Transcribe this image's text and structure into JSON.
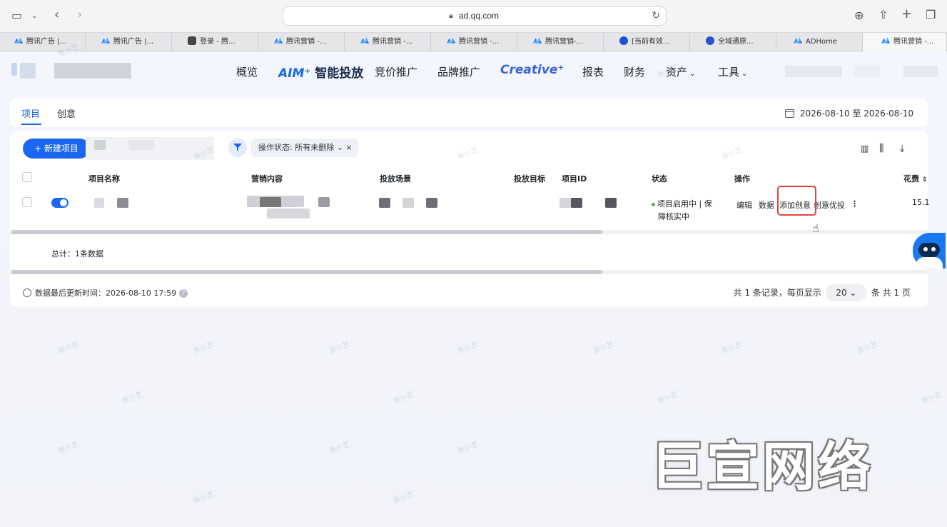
{
  "browser": {
    "url": "ad.qq.com",
    "tabs": [
      {
        "label": "腾讯广告 |...",
        "fav": "tencent-ads-icon"
      },
      {
        "label": "腾讯广告 |...",
        "fav": "tencent-ads-icon"
      },
      {
        "label": "登录 - 腾...",
        "fav": "q-icon"
      },
      {
        "label": "腾讯营销 -...",
        "fav": "tencent-ads-icon"
      },
      {
        "label": "腾讯营销 -...",
        "fav": "tencent-ads-icon"
      },
      {
        "label": "腾讯营销 -...",
        "fav": "tencent-ads-icon"
      },
      {
        "label": "腾讯营销-...",
        "fav": "tencent-ads-icon"
      },
      {
        "label": "[当前有效...",
        "fav": "it-icon"
      },
      {
        "label": "全域通原...",
        "fav": "oe-icon"
      },
      {
        "label": "ADHome",
        "fav": "tencent-ads-icon"
      },
      {
        "label": "腾讯营销 -...",
        "fav": "tencent-ads-icon"
      }
    ]
  },
  "nav": {
    "items": [
      "概览",
      "竞价推广",
      "品牌推广",
      "报表",
      "财务"
    ],
    "aim_prefix": "AIM⁺",
    "aim_label": "智能投放",
    "creative": "Creative⁺",
    "assets": "资产",
    "tools": "工具"
  },
  "subtabs": {
    "project": "项目",
    "creative": "创意",
    "date_range": "2026-08-10 至 2026-08-10"
  },
  "toolbar": {
    "new_button": "+ 新建项目",
    "filter_label": "操作状态: 所有未删除"
  },
  "table": {
    "headers": [
      "项目名称",
      "营销内容",
      "投放场景",
      "投放目标",
      "项目ID",
      "状态",
      "操作",
      "花费"
    ],
    "row": {
      "status_line1": "项目启用中 | 保",
      "status_line2": "障核实中",
      "actions": [
        "编辑",
        "数据",
        "添加创意",
        "创意优投"
      ],
      "more": "⋮",
      "spend": "15.1"
    },
    "total": "总计：1条数据"
  },
  "footer": {
    "updated": "数据最后更新时间：2026-08-10 17:59",
    "pager_prefix": "共 1 条记录，每页显示",
    "page_size": "20",
    "pager_suffix": "条 共 1 页"
  },
  "watermark_text": "张小艺",
  "brand_watermark": "巨宣网络",
  "colors": {
    "primary": "#1a66f0",
    "highlight": "#e0453c",
    "status_dot": "#4cb050"
  }
}
